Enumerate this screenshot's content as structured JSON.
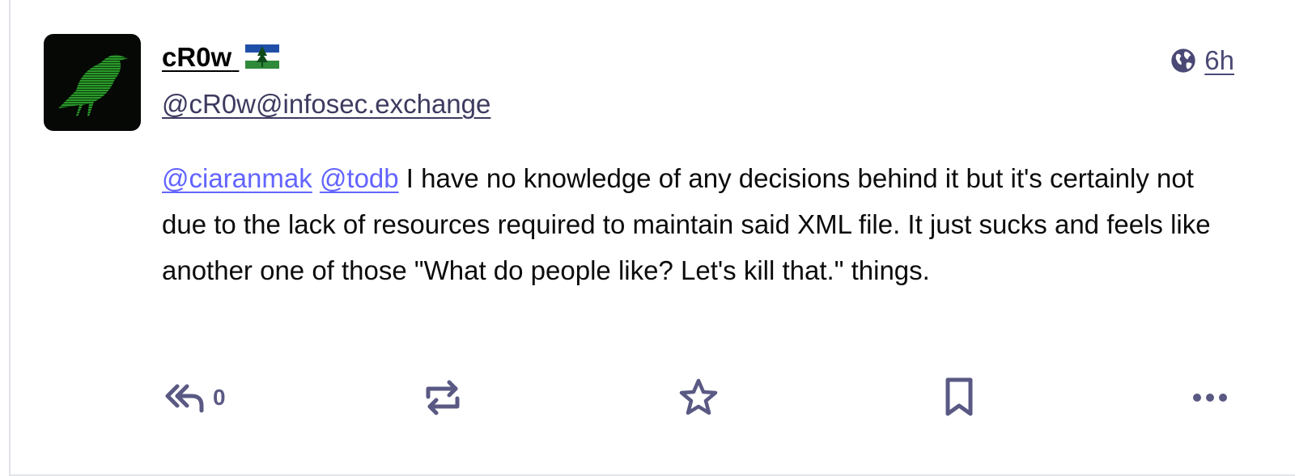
{
  "post": {
    "display_name": "cR0w",
    "handle": "@cR0w@infosec.exchange",
    "visibility_icon": "globe-icon",
    "relative_time": "6h",
    "mentions": [
      "@ciaranmak",
      "@todb"
    ],
    "body": " I have no knowledge of any decisions behind it but it's certainly not due to the lack of resources required to maintain said XML file. It just sucks and feels like another one of those \"What do people like? Let's kill that.\" things."
  },
  "actions": {
    "reply_count": "0",
    "reply_icon": "reply-all-icon",
    "boost_icon": "boost-icon",
    "favourite_icon": "star-icon",
    "bookmark_icon": "bookmark-icon",
    "more_icon": "more-horizontal-icon"
  },
  "colors": {
    "mention": "#6364ff",
    "icon": "#5a5984",
    "avatar_crow": "#1f7a1f"
  }
}
